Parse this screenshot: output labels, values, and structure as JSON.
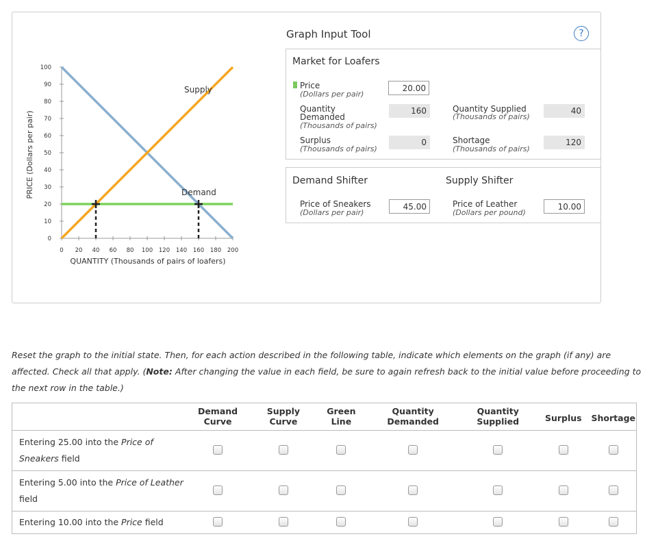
{
  "tool": {
    "title": "Graph Input Tool",
    "help": "?"
  },
  "graph": {
    "ylabel": "PRICE (Dollars per pair)",
    "xlabel": "QUANTITY (Thousands of pairs of loafers)",
    "supply_label": "Supply",
    "demand_label": "Demand",
    "colors": {
      "supply": "#f5a623",
      "demand": "#8ab0d0",
      "green_line": "#7cd35c",
      "marker": "#222222"
    }
  },
  "chart_data": {
    "type": "line",
    "xlabel": "QUANTITY (Thousands of pairs of loafers)",
    "ylabel": "PRICE (Dollars per pair)",
    "xlim": [
      0,
      200
    ],
    "ylim": [
      0,
      100
    ],
    "x_ticks": [
      "0",
      "20",
      "40",
      "60",
      "80",
      "100",
      "120",
      "140",
      "160",
      "180",
      "200"
    ],
    "y_ticks": [
      "0",
      "10",
      "20",
      "30",
      "40",
      "50",
      "60",
      "70",
      "80",
      "90",
      "100"
    ],
    "series": [
      {
        "name": "Supply",
        "x": [
          0,
          200
        ],
        "y": [
          0,
          100
        ]
      },
      {
        "name": "Demand",
        "x": [
          0,
          200
        ],
        "y": [
          100,
          0
        ]
      },
      {
        "name": "",
        "x": [
          0,
          200
        ],
        "y": [
          20,
          20
        ]
      }
    ],
    "markers": [
      {
        "x": 40,
        "y": 20
      },
      {
        "x": 160,
        "y": 20
      }
    ]
  },
  "market": {
    "title": "Market for Loafers",
    "price_label": "Price",
    "price_unit": "(Dollars per pair)",
    "price_value": "20.00",
    "qd_label_1": "Quantity",
    "qd_label_2": "Demanded",
    "qd_unit": "(Thousands of pairs)",
    "qd_value": "160",
    "qs_label": "Quantity Supplied",
    "qs_unit": "(Thousands of pairs)",
    "qs_value": "40",
    "surplus_label": "Surplus",
    "surplus_unit": "(Thousands of pairs)",
    "surplus_value": "0",
    "shortage_label": "Shortage",
    "shortage_unit": "(Thousands of pairs)",
    "shortage_value": "120"
  },
  "shifters": {
    "demand_title": "Demand Shifter",
    "supply_title": "Supply Shifter",
    "sneakers_label": "Price of Sneakers",
    "sneakers_unit": "(Dollars per pair)",
    "sneakers_value": "45.00",
    "leather_label": "Price of Leather",
    "leather_unit": "(Dollars per pound)",
    "leather_value": "10.00"
  },
  "instructions": {
    "part1": "Reset the graph to the initial state. Then, for each action described in the following table, indicate which elements on the graph (if any) are affected. Check all that apply. (",
    "note_label": "Note:",
    "part2": " After changing the value in each field, be sure to again refresh back to the initial value before proceeding to the next row in the table.)"
  },
  "table": {
    "headers": [
      {
        "l1": "Demand",
        "l2": "Curve"
      },
      {
        "l1": "Supply",
        "l2": "Curve"
      },
      {
        "l1": "Green",
        "l2": "Line"
      },
      {
        "l1": "Quantity",
        "l2": "Demanded"
      },
      {
        "l1": "Quantity",
        "l2": "Supplied"
      },
      {
        "l1": "Surplus",
        "l2": ""
      },
      {
        "l1": "Shortage",
        "l2": ""
      }
    ],
    "rows": [
      {
        "pre": "Entering 25.00 into the ",
        "field": "Price of Sneakers",
        "post": " field"
      },
      {
        "pre": "Entering 5.00 into the ",
        "field": "Price of Leather",
        "post": " field"
      },
      {
        "pre": "Entering 10.00 into the ",
        "field": "Price",
        "post": " field"
      }
    ]
  }
}
